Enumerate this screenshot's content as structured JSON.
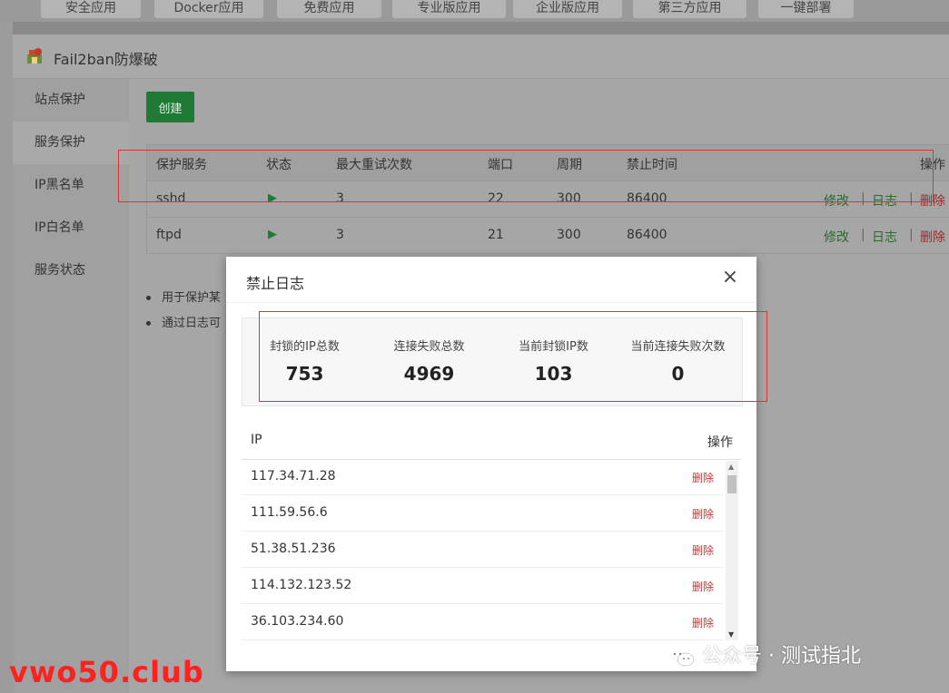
{
  "top_tabs": [
    "安全应用",
    "Docker应用",
    "免费应用",
    "专业版应用",
    "企业版应用",
    "第三方应用",
    "一键部署"
  ],
  "window": {
    "title": "Fail2ban防爆破"
  },
  "sidebar": {
    "items": [
      {
        "label": "站点保护"
      },
      {
        "label": "服务保护"
      },
      {
        "label": "IP黑名单"
      },
      {
        "label": "IP白名单"
      },
      {
        "label": "服务状态"
      }
    ]
  },
  "content": {
    "create_label": "创建",
    "table": {
      "headers": [
        "保护服务",
        "状态",
        "最大重试次数",
        "端口",
        "周期",
        "禁止时间",
        "操作"
      ],
      "rows": [
        {
          "service": "sshd",
          "retries": "3",
          "port": "22",
          "period": "300",
          "ban_time": "86400"
        },
        {
          "service": "ftpd",
          "retries": "3",
          "port": "21",
          "period": "300",
          "ban_time": "86400"
        }
      ],
      "actions": {
        "edit": "修改",
        "log": "日志",
        "delete": "删除",
        "sep": "|"
      }
    },
    "notes": [
      "用于保护某",
      "通过日志可"
    ]
  },
  "modal": {
    "title": "禁止日志",
    "close_symbol": "×",
    "stats": [
      {
        "label": "封锁的IP总数",
        "value": "753"
      },
      {
        "label": "连接失败总数",
        "value": "4969"
      },
      {
        "label": "当前封锁IP数",
        "value": "103"
      },
      {
        "label": "当前连接失败次数",
        "value": "0"
      }
    ],
    "ip_table": {
      "headers": [
        "IP",
        "操作"
      ],
      "rows": [
        {
          "ip": "117.34.71.28",
          "action": "删除"
        },
        {
          "ip": "111.59.56.6",
          "action": "删除"
        },
        {
          "ip": "51.38.51.236",
          "action": "删除"
        },
        {
          "ip": "114.132.123.52",
          "action": "删除"
        },
        {
          "ip": "36.103.234.60",
          "action": "删除"
        }
      ]
    }
  },
  "watermarks": {
    "left": "vwo50.club",
    "right": "公众号 · 测试指北"
  },
  "colors": {
    "green": "#20a53a",
    "danger": "#cc3333",
    "highlight": "#dd3333"
  }
}
